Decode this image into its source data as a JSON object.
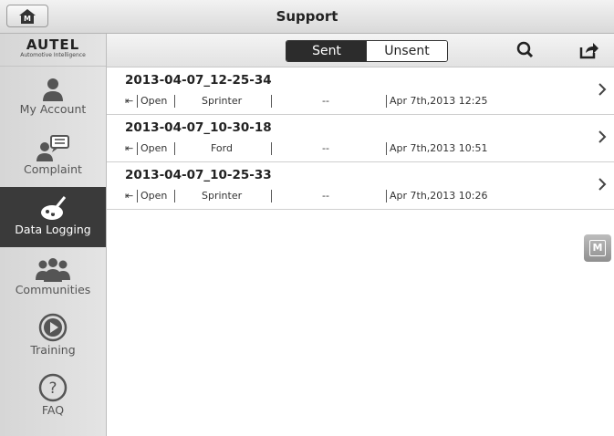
{
  "header": {
    "title": "Support",
    "home_badge": "M"
  },
  "logo": {
    "main": "AUTEL",
    "sub": "Automotive Intelligence"
  },
  "sidebar": {
    "items": [
      {
        "label": "My Account",
        "icon": "person-icon",
        "active": false
      },
      {
        "label": "Complaint",
        "icon": "complaint-icon",
        "active": false
      },
      {
        "label": "Data Logging",
        "icon": "data-logging-icon",
        "active": true
      },
      {
        "label": "Communities",
        "icon": "group-icon",
        "active": false
      },
      {
        "label": "Training",
        "icon": "play-circle-icon",
        "active": false
      },
      {
        "label": "FAQ",
        "icon": "question-circle-icon",
        "active": false
      }
    ]
  },
  "toolbar": {
    "tab_sent": "Sent",
    "tab_unsent": "Unsent",
    "active_tab": "Sent",
    "search_icon": "search-icon",
    "share_icon": "share-icon"
  },
  "records": [
    {
      "title": "2013-04-07_12-25-34",
      "status": "Open",
      "vehicle": "Sprinter",
      "info": "--",
      "date": "Apr 7th,2013 12:25"
    },
    {
      "title": "2013-04-07_10-30-18",
      "status": "Open",
      "vehicle": "Ford",
      "info": "--",
      "date": "Apr 7th,2013 10:51"
    },
    {
      "title": "2013-04-07_10-25-33",
      "status": "Open",
      "vehicle": "Sprinter",
      "info": "--",
      "date": "Apr 7th,2013 10:26"
    }
  ],
  "floating": {
    "label": "M"
  }
}
